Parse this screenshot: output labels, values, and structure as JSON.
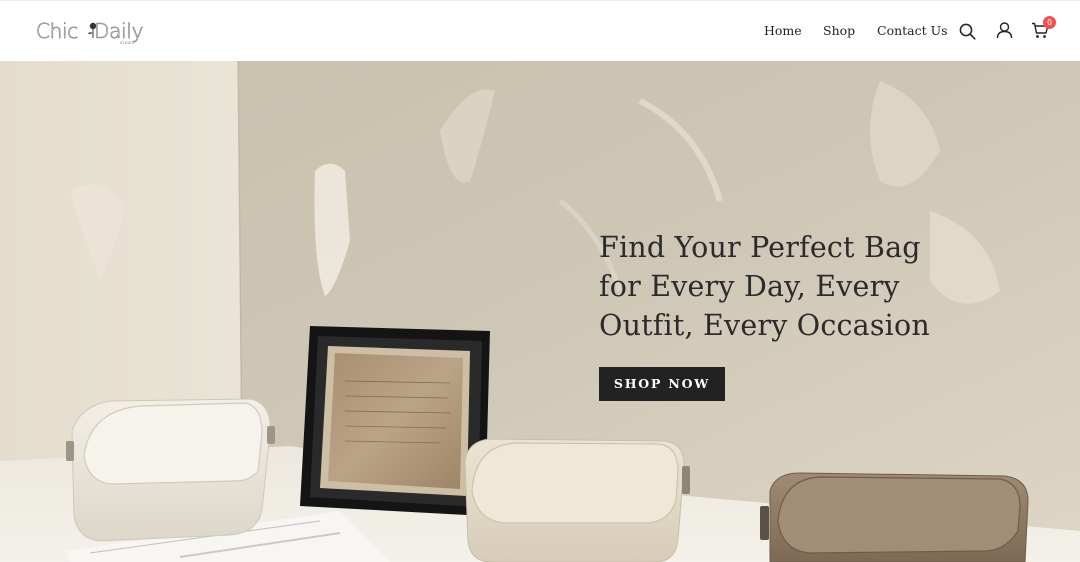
{
  "brand": {
    "name_part1": "Chic",
    "name_part2": "Daily",
    "logo_icon": "rose-icon",
    "tagline": "STUDIO"
  },
  "nav": {
    "items": [
      {
        "label": "Home"
      },
      {
        "label": "Shop"
      },
      {
        "label": "Contact Us"
      }
    ]
  },
  "header_icons": {
    "search": "search-icon",
    "account": "user-icon",
    "cart": "cart-icon",
    "cart_count": "0",
    "badge_color": "#ef5350"
  },
  "hero": {
    "title": "Find Your Perfect Bag for Every Day, Every Outfit, Every Occasion",
    "cta_label": "SHOP NOW",
    "cta_color": "#222222",
    "image_subject": "three leather crossbody bags beside a framed handwritten note on a textured plaster wall"
  }
}
